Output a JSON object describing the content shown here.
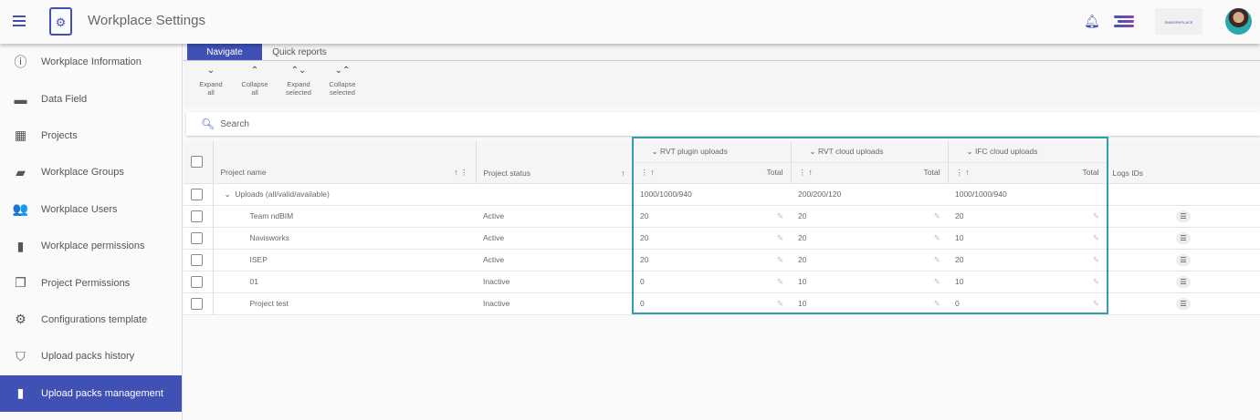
{
  "header": {
    "title": "Workplace Settings",
    "brand": "SNWORKPLACE"
  },
  "sidebar": {
    "items": [
      {
        "label": "Workplace Information",
        "icon": "ⓘ"
      },
      {
        "label": "Data Field",
        "icon": "▬"
      },
      {
        "label": "Projects",
        "icon": "▦"
      },
      {
        "label": "Workplace Groups",
        "icon": "▰"
      },
      {
        "label": "Workplace Users",
        "icon": "👥"
      },
      {
        "label": "Workplace permissions",
        "icon": "▮"
      },
      {
        "label": "Project Permissions",
        "icon": "❐"
      },
      {
        "label": "Configurations template",
        "icon": "⚙"
      },
      {
        "label": "Upload packs history",
        "icon": "⛉"
      },
      {
        "label": "Upload packs management",
        "icon": "▮"
      }
    ]
  },
  "tabs": [
    "Navigate",
    "Quick reports"
  ],
  "toolbar": [
    {
      "l1": "Expand",
      "l2": "all",
      "icon": "⌄"
    },
    {
      "l1": "Collapse",
      "l2": "all",
      "icon": "⌃"
    },
    {
      "l1": "Expand",
      "l2": "selected",
      "icon": "⌃⌄"
    },
    {
      "l1": "Collapse",
      "l2": "selected",
      "icon": "⌄⌃"
    }
  ],
  "search": {
    "placeholder": "Search"
  },
  "table": {
    "headers": {
      "name": "Project name",
      "status": "Project status",
      "g1": "RVT plugin uploads",
      "g2": "RVT cloud uploads",
      "g3": "IFC cloud uploads",
      "total": "Total",
      "logs": "Logs IDs"
    },
    "group": {
      "label": "Uploads (all/valid/available)",
      "v1": "1000/1000/940",
      "v2": "200/200/120",
      "v3": "1000/1000/940"
    },
    "rows": [
      {
        "name": "Team ndBIM",
        "status": "Active",
        "v1": "20",
        "v2": "20",
        "v3": "20"
      },
      {
        "name": "Navisworks",
        "status": "Active",
        "v1": "20",
        "v2": "20",
        "v3": "10"
      },
      {
        "name": "ISEP",
        "status": "Active",
        "v1": "20",
        "v2": "20",
        "v3": "20"
      },
      {
        "name": "01",
        "status": "Inactive",
        "v1": "0",
        "v2": "10",
        "v3": "10"
      },
      {
        "name": "Project test",
        "status": "Inactive",
        "v1": "0",
        "v2": "10",
        "v3": "0"
      }
    ]
  }
}
